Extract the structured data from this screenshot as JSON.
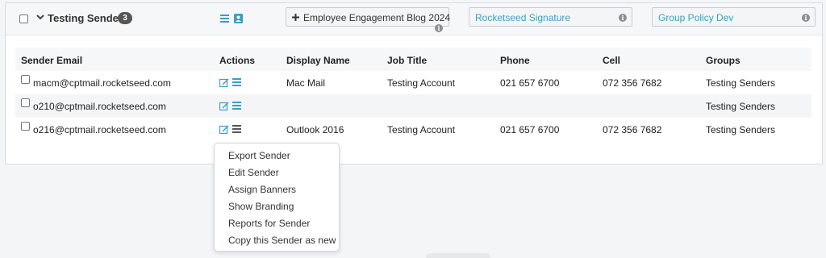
{
  "group": {
    "title": "Testing Senders",
    "count": "3"
  },
  "tags": [
    {
      "label": "Employee Engagement Blog 2024",
      "icon": "plus-icon"
    },
    {
      "label": "Rocketseed Signature"
    },
    {
      "label": "Group Policy Dev"
    }
  ],
  "table": {
    "headers": [
      "Sender Email",
      "Actions",
      "Display Name",
      "Job Title",
      "Phone",
      "Cell",
      "Groups"
    ],
    "rows": [
      {
        "email": "macm@cptmail.rocketseed.com",
        "display_name": "Mac Mail",
        "job_title": "Testing Account",
        "phone": "021 657 6700",
        "cell": "072 356 7682",
        "groups": "Testing Senders"
      },
      {
        "email": "o210@cptmail.rocketseed.com",
        "display_name": "",
        "job_title": "",
        "phone": "",
        "cell": "",
        "groups": "Testing Senders"
      },
      {
        "email": "o216@cptmail.rocketseed.com",
        "display_name": "Outlook 2016",
        "job_title": "Testing Account",
        "phone": "021 657 6700",
        "cell": "072 356 7682",
        "groups": "Testing Senders"
      }
    ]
  },
  "menu": {
    "items": [
      "Export Sender",
      "Edit Sender",
      "Assign Banners",
      "Show Branding",
      "Reports for Sender",
      "Copy this Sender as new"
    ]
  },
  "colors": {
    "accent": "#3a9fc4",
    "link": "#3a9fc4",
    "badge": "#555555"
  }
}
